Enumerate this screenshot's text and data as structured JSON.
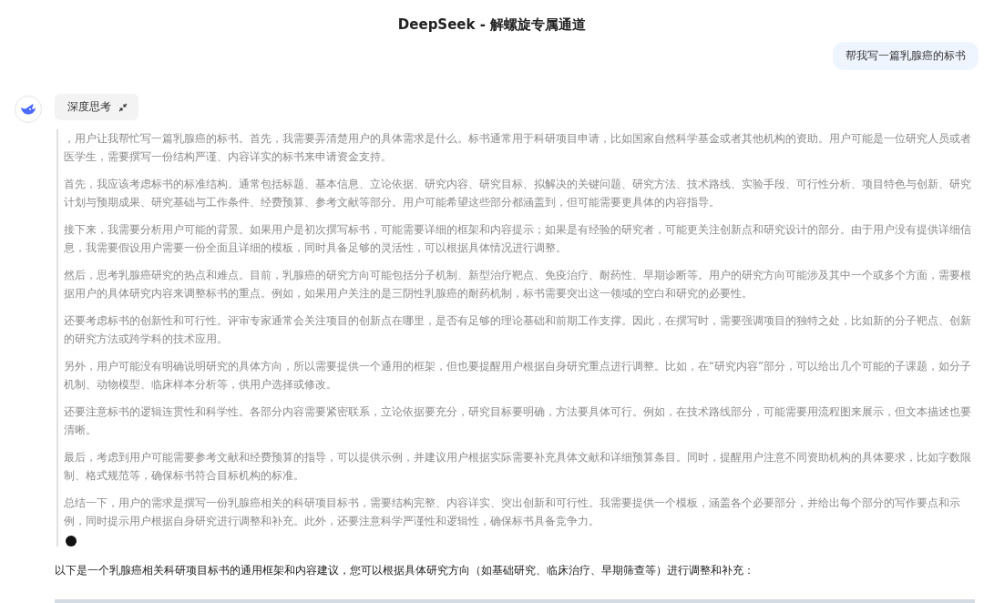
{
  "header": {
    "title": "DeepSeek - 解螺旋专属通道"
  },
  "user_message": {
    "text": "帮我写一篇乳腺癌的标书"
  },
  "thinking": {
    "label": "深度思考",
    "expanded": true,
    "paragraphs": [
      "，用户让我帮忙写一篇乳腺癌的标书。首先，我需要弄清楚用户的具体需求是什么。标书通常用于科研项目申请，比如国家自然科学基金或者其他机构的资助。用户可能是一位研究人员或者医学生，需要撰写一份结构严谨、内容详实的标书来申请资金支持。",
      "首先，我应该考虑标书的标准结构。通常包括标题、基本信息、立论依据、研究内容、研究目标、拟解决的关键问题、研究方法、技术路线、实验手段、可行性分析、项目特色与创新、研究计划与预期成果、研究基础与工作条件、经费预算、参考文献等部分。用户可能希望这些部分都涵盖到，但可能需要更具体的内容指导。",
      "接下来，我需要分析用户可能的背景。如果用户是初次撰写标书，可能需要详细的框架和内容提示；如果是有经验的研究者，可能更关注创新点和研究设计的部分。由于用户没有提供详细信息，我需要假设用户需要一份全面且详细的模板，同时具备足够的灵活性，可以根据具体情况进行调整。",
      "然后，思考乳腺癌研究的热点和难点。目前，乳腺癌的研究方向可能包括分子机制、新型治疗靶点、免疫治疗、耐药性、早期诊断等。用户的研究方向可能涉及其中一个或多个方面，需要根据用户的具体研究内容来调整标书的重点。例如，如果用户关注的是三阴性乳腺癌的耐药机制，标书需要突出这一领域的空白和研究的必要性。",
      "还要考虑标书的创新性和可行性。评审专家通常会关注项目的创新点在哪里，是否有足够的理论基础和前期工作支撑。因此，在撰写时，需要强调项目的独特之处，比如新的分子靶点、创新的研究方法或跨学科的技术应用。",
      "另外，用户可能没有明确说明研究的具体方向，所以需要提供一个通用的框架，但也要提醒用户根据自身研究重点进行调整。比如，在“研究内容”部分，可以给出几个可能的子课题，如分子机制、动物模型、临床样本分析等，供用户选择或修改。",
      "还要注意标书的逻辑连贯性和科学性。各部分内容需要紧密联系，立论依据要充分，研究目标要明确，方法要具体可行。例如，在技术路线部分，可能需要用流程图来展示，但文本描述也要清晰。",
      "最后，考虑到用户可能需要参考文献和经费预算的指导，可以提供示例，并建议用户根据实际需要补充具体文献和详细预算条目。同时，提醒用户注意不同资助机构的具体要求，比如字数限制、格式规范等，确保标书符合目标机构的标准。",
      "总结一下，用户的需求是撰写一份乳腺癌相关的科研项目标书，需要结构完整、内容详实、突出创新和可行性。我需要提供一个模板，涵盖各个必要部分，并给出每个部分的写作要点和示例，同时提示用户根据自身研究进行调整和补充。此外，还要注意科学严谨性和逻辑性，确保标书具备竞争力。"
    ]
  },
  "answer": {
    "text": "以下是一个乳腺癌相关科研项目标书的通用框架和内容建议，您可以根据具体研究方向（如基础研究、临床治疗、早期筛查等）进行调整和补充："
  }
}
